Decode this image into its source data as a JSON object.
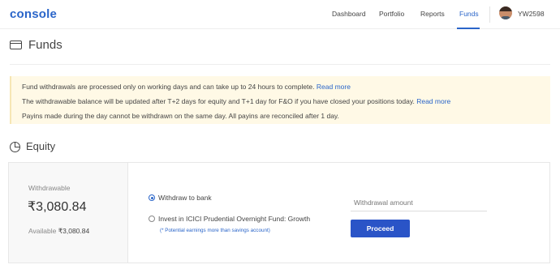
{
  "header": {
    "logo": "console",
    "nav": [
      {
        "label": "Dashboard",
        "active": false
      },
      {
        "label": "Portfolio",
        "active": false
      },
      {
        "label": "Reports",
        "active": false
      },
      {
        "label": "Funds",
        "active": true
      }
    ],
    "user_id": "YW2598",
    "accent_color": "#2a65c9"
  },
  "page": {
    "title": "Funds",
    "title_icon": "wallet-icon"
  },
  "notice": {
    "line1": "Fund withdrawals are processed only on working days and can take up to 24 hours to complete.",
    "line1_link": "Read more",
    "line2": "The withdrawable balance will be updated after T+2 days for equity and T+1 day for F&O if you have closed your positions today.",
    "line2_link": "Read more",
    "line3": "Payins made during the day cannot be withdrawn on the same day. All payins are reconciled after 1 day.",
    "background_color": "#fff9e6"
  },
  "equity": {
    "title": "Equity",
    "title_icon": "pie-chart-icon",
    "withdrawable_label": "Withdrawable",
    "withdrawable_amount": "₹3,080.84",
    "available_label": "Available",
    "available_amount": "₹3,080.84",
    "options": [
      {
        "label": "Withdraw to bank",
        "selected": true
      },
      {
        "label": "Invest in ICICI Prudential Overnight Fund: Growth",
        "selected": false
      }
    ],
    "option_note": "(* Potential earnings more than savings account)",
    "amount_placeholder": "Withdrawal amount",
    "proceed_label": "Proceed",
    "button_color": "#2a54c7"
  }
}
